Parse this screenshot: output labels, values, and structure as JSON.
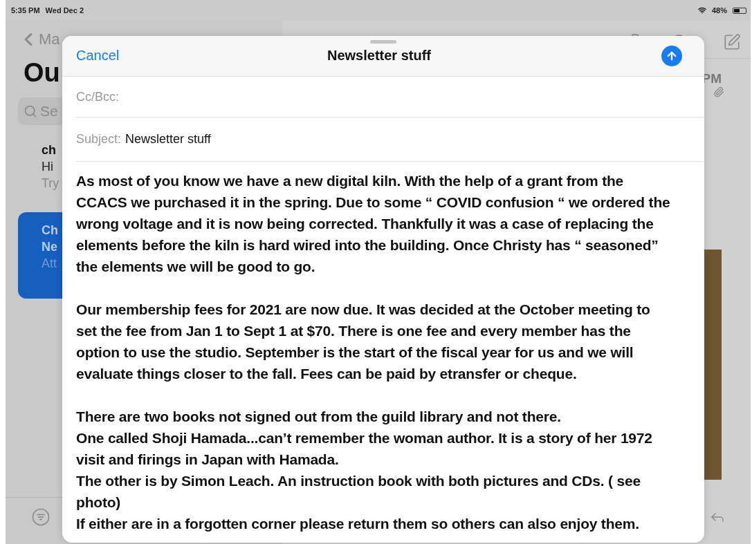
{
  "status_bar": {
    "time": "5:35 PM",
    "date": "Wed Dec 2",
    "battery": "48%"
  },
  "mailbox": {
    "back_label": "Ma",
    "title": "Ou",
    "search_placeholder": "Se",
    "messages": [
      {
        "sender": "ch",
        "subject": "Hi",
        "preview": "Try",
        "selected": false
      },
      {
        "sender": "Ch",
        "subject": "Ne",
        "preview": "Att",
        "selected": true
      }
    ]
  },
  "message_view": {
    "time": "PM"
  },
  "compose": {
    "cancel": "Cancel",
    "title": "Newsletter stuff",
    "cc_label": "Cc/Bcc:",
    "subject_label": "Subject:",
    "subject": "Newsletter stuff",
    "body": [
      [
        "As most of you know we have a new digital kiln. With the help of a grant from the",
        "CCACS we purchased it in the spring. Due to some “ COVID confusion “ we ordered the",
        "wrong voltage and it is now being corrected. Thankfully it was a case of replacing the",
        "elements before the kiln is hard wired into the building. Once Christy has “ seasoned”",
        "the elements we will be good to go."
      ],
      [
        "Our membership fees for 2021 are now due. It was decided at the October meeting to",
        "set the fee from Jan 1 to Sept 1 at $70. There is one fee and every member has the",
        "option to use the studio. September is the start of the fiscal year for us and we will",
        "evaluate things closer to the fall. Fees can be paid by etransfer or cheque."
      ],
      [
        "There are two books not signed out from the guild library and not there.",
        "One called Shoji Hamada...can’t remember the woman author. It is a story of her 1972",
        "visit and firings in Japan with Hamada.",
        "The other is by Simon Leach. An instruction book with both pictures and CDs. ( see",
        "photo)",
        "If either are in a forgotten corner please return them so others can also enjoy them."
      ]
    ]
  }
}
